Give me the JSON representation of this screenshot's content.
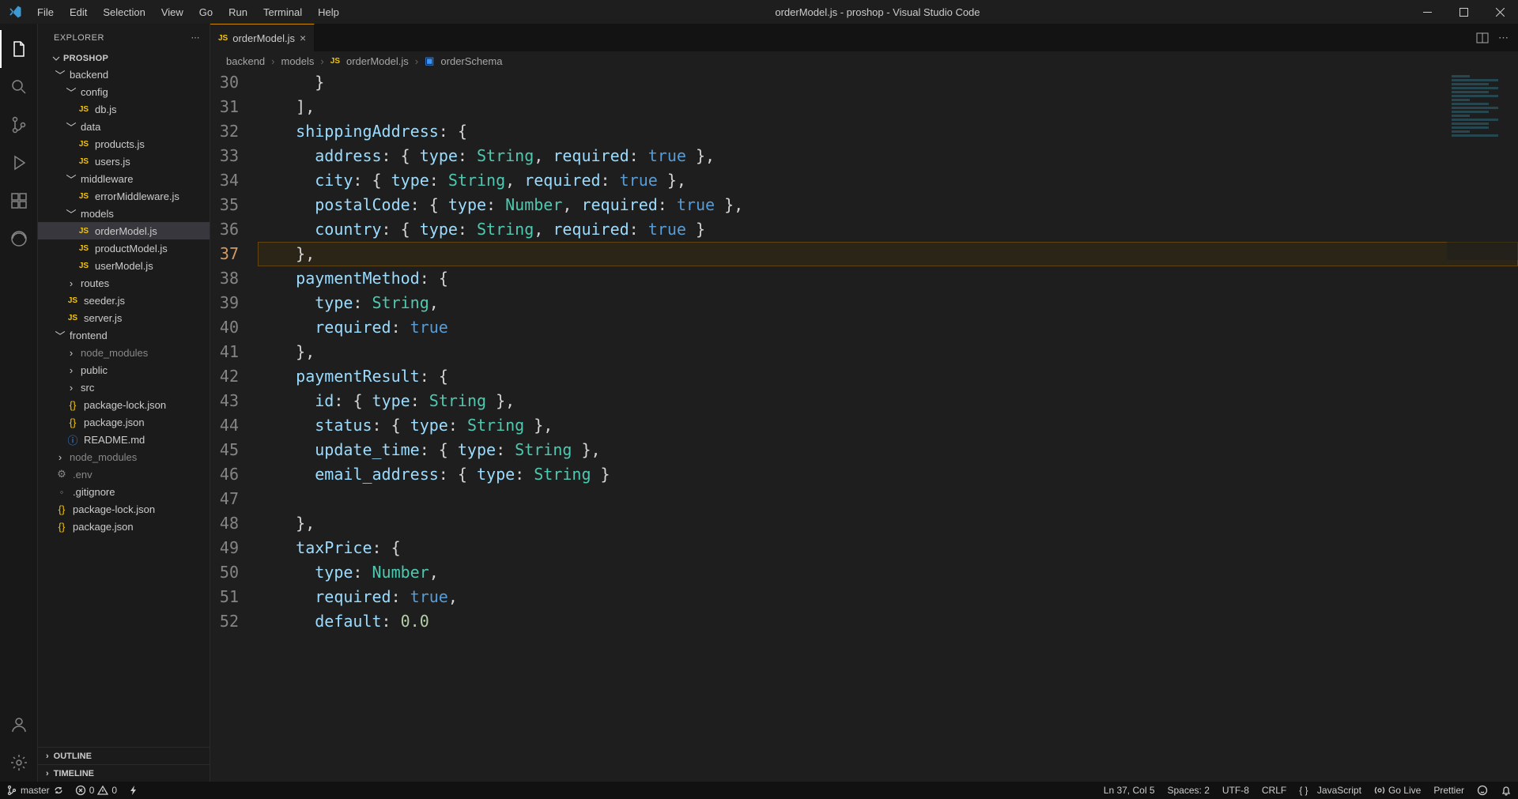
{
  "window": {
    "title": "orderModel.js - proshop - Visual Studio Code"
  },
  "menu": [
    "File",
    "Edit",
    "Selection",
    "View",
    "Go",
    "Run",
    "Terminal",
    "Help"
  ],
  "explorer": {
    "title": "EXPLORER",
    "project": "PROSHOP",
    "tree": {
      "backend": "backend",
      "config": "config",
      "db": "db.js",
      "data": "data",
      "products": "products.js",
      "users": "users.js",
      "middleware": "middleware",
      "errorMiddleware": "errorMiddleware.js",
      "models": "models",
      "orderModel": "orderModel.js",
      "productModel": "productModel.js",
      "userModel": "userModel.js",
      "routes": "routes",
      "seeder": "seeder.js",
      "server": "server.js",
      "frontend": "frontend",
      "node_modules_fe": "node_modules",
      "public": "public",
      "src": "src",
      "pkglock_fe": "package-lock.json",
      "pkg_fe": "package.json",
      "readme": "README.md",
      "node_modules_root": "node_modules",
      "env": ".env",
      "gitignore": ".gitignore",
      "pkglock_root": "package-lock.json",
      "pkg_root": "package.json"
    },
    "outline": "OUTLINE",
    "timeline": "TIMELINE"
  },
  "tab": {
    "fileLabel": "orderModel.js"
  },
  "breadcrumb": {
    "seg1": "backend",
    "seg2": "models",
    "seg3": "orderModel.js",
    "seg4": "orderSchema"
  },
  "code": {
    "lineStart": 30,
    "lines": [
      {
        "n": 30,
        "segs": [
          {
            "t": "      ",
            "c": "guide"
          },
          {
            "t": "}",
            "c": "brace"
          }
        ]
      },
      {
        "n": 31,
        "segs": [
          {
            "t": "    ",
            "c": "guide"
          },
          {
            "t": "],",
            "c": "punc"
          }
        ]
      },
      {
        "n": 32,
        "segs": [
          {
            "t": "    ",
            "c": "guide"
          },
          {
            "t": "shippingAddress",
            "c": "key"
          },
          {
            "t": ": ",
            "c": "punc"
          },
          {
            "t": "{",
            "c": "brace"
          }
        ]
      },
      {
        "n": 33,
        "segs": [
          {
            "t": "      ",
            "c": "guide"
          },
          {
            "t": "address",
            "c": "key"
          },
          {
            "t": ": ",
            "c": "punc"
          },
          {
            "t": "{ ",
            "c": "brace"
          },
          {
            "t": "type",
            "c": "key"
          },
          {
            "t": ": ",
            "c": "punc"
          },
          {
            "t": "String",
            "c": "type"
          },
          {
            "t": ", ",
            "c": "punc"
          },
          {
            "t": "required",
            "c": "key"
          },
          {
            "t": ": ",
            "c": "punc"
          },
          {
            "t": "true",
            "c": "bool"
          },
          {
            "t": " }",
            "c": "brace"
          },
          {
            "t": ",",
            "c": "punc"
          }
        ]
      },
      {
        "n": 34,
        "segs": [
          {
            "t": "      ",
            "c": "guide"
          },
          {
            "t": "city",
            "c": "key"
          },
          {
            "t": ": ",
            "c": "punc"
          },
          {
            "t": "{ ",
            "c": "brace"
          },
          {
            "t": "type",
            "c": "key"
          },
          {
            "t": ": ",
            "c": "punc"
          },
          {
            "t": "String",
            "c": "type"
          },
          {
            "t": ", ",
            "c": "punc"
          },
          {
            "t": "required",
            "c": "key"
          },
          {
            "t": ": ",
            "c": "punc"
          },
          {
            "t": "true",
            "c": "bool"
          },
          {
            "t": " }",
            "c": "brace"
          },
          {
            "t": ",",
            "c": "punc"
          }
        ]
      },
      {
        "n": 35,
        "segs": [
          {
            "t": "      ",
            "c": "guide"
          },
          {
            "t": "postalCode",
            "c": "key"
          },
          {
            "t": ": ",
            "c": "punc"
          },
          {
            "t": "{ ",
            "c": "brace"
          },
          {
            "t": "type",
            "c": "key"
          },
          {
            "t": ": ",
            "c": "punc"
          },
          {
            "t": "Number",
            "c": "type"
          },
          {
            "t": ", ",
            "c": "punc"
          },
          {
            "t": "required",
            "c": "key"
          },
          {
            "t": ": ",
            "c": "punc"
          },
          {
            "t": "true",
            "c": "bool"
          },
          {
            "t": " }",
            "c": "brace"
          },
          {
            "t": ",",
            "c": "punc"
          }
        ]
      },
      {
        "n": 36,
        "segs": [
          {
            "t": "      ",
            "c": "guide"
          },
          {
            "t": "country",
            "c": "key"
          },
          {
            "t": ": ",
            "c": "punc"
          },
          {
            "t": "{ ",
            "c": "brace"
          },
          {
            "t": "type",
            "c": "key"
          },
          {
            "t": ": ",
            "c": "punc"
          },
          {
            "t": "String",
            "c": "type"
          },
          {
            "t": ", ",
            "c": "punc"
          },
          {
            "t": "required",
            "c": "key"
          },
          {
            "t": ": ",
            "c": "punc"
          },
          {
            "t": "true",
            "c": "bool"
          },
          {
            "t": " }",
            "c": "brace"
          }
        ]
      },
      {
        "n": 37,
        "hl": true,
        "segs": [
          {
            "t": "    ",
            "c": "guide"
          },
          {
            "t": "}",
            "c": "brace"
          },
          {
            "t": ",",
            "c": "punc"
          }
        ]
      },
      {
        "n": 38,
        "segs": [
          {
            "t": "    ",
            "c": "guide"
          },
          {
            "t": "paymentMethod",
            "c": "key"
          },
          {
            "t": ": ",
            "c": "punc"
          },
          {
            "t": "{",
            "c": "brace"
          }
        ]
      },
      {
        "n": 39,
        "segs": [
          {
            "t": "      ",
            "c": "guide"
          },
          {
            "t": "type",
            "c": "key"
          },
          {
            "t": ": ",
            "c": "punc"
          },
          {
            "t": "String",
            "c": "type"
          },
          {
            "t": ",",
            "c": "punc"
          }
        ]
      },
      {
        "n": 40,
        "segs": [
          {
            "t": "      ",
            "c": "guide"
          },
          {
            "t": "required",
            "c": "key"
          },
          {
            "t": ": ",
            "c": "punc"
          },
          {
            "t": "true",
            "c": "bool"
          }
        ]
      },
      {
        "n": 41,
        "segs": [
          {
            "t": "    ",
            "c": "guide"
          },
          {
            "t": "}",
            "c": "brace"
          },
          {
            "t": ",",
            "c": "punc"
          }
        ]
      },
      {
        "n": 42,
        "segs": [
          {
            "t": "    ",
            "c": "guide"
          },
          {
            "t": "paymentResult",
            "c": "key"
          },
          {
            "t": ": ",
            "c": "punc"
          },
          {
            "t": "{",
            "c": "brace"
          }
        ]
      },
      {
        "n": 43,
        "segs": [
          {
            "t": "      ",
            "c": "guide"
          },
          {
            "t": "id",
            "c": "key"
          },
          {
            "t": ": ",
            "c": "punc"
          },
          {
            "t": "{ ",
            "c": "brace"
          },
          {
            "t": "type",
            "c": "key"
          },
          {
            "t": ": ",
            "c": "punc"
          },
          {
            "t": "String",
            "c": "type"
          },
          {
            "t": " }",
            "c": "brace"
          },
          {
            "t": ",",
            "c": "punc"
          }
        ]
      },
      {
        "n": 44,
        "segs": [
          {
            "t": "      ",
            "c": "guide"
          },
          {
            "t": "status",
            "c": "key"
          },
          {
            "t": ": ",
            "c": "punc"
          },
          {
            "t": "{ ",
            "c": "brace"
          },
          {
            "t": "type",
            "c": "key"
          },
          {
            "t": ": ",
            "c": "punc"
          },
          {
            "t": "String",
            "c": "type"
          },
          {
            "t": " }",
            "c": "brace"
          },
          {
            "t": ",",
            "c": "punc"
          }
        ]
      },
      {
        "n": 45,
        "segs": [
          {
            "t": "      ",
            "c": "guide"
          },
          {
            "t": "update_time",
            "c": "key"
          },
          {
            "t": ": ",
            "c": "punc"
          },
          {
            "t": "{ ",
            "c": "brace"
          },
          {
            "t": "type",
            "c": "key"
          },
          {
            "t": ": ",
            "c": "punc"
          },
          {
            "t": "String",
            "c": "type"
          },
          {
            "t": " }",
            "c": "brace"
          },
          {
            "t": ",",
            "c": "punc"
          }
        ]
      },
      {
        "n": 46,
        "segs": [
          {
            "t": "      ",
            "c": "guide"
          },
          {
            "t": "email_address",
            "c": "key"
          },
          {
            "t": ": ",
            "c": "punc"
          },
          {
            "t": "{ ",
            "c": "brace"
          },
          {
            "t": "type",
            "c": "key"
          },
          {
            "t": ": ",
            "c": "punc"
          },
          {
            "t": "String",
            "c": "type"
          },
          {
            "t": " }",
            "c": "brace"
          }
        ]
      },
      {
        "n": 47,
        "segs": [
          {
            "t": " ",
            "c": "guide"
          }
        ]
      },
      {
        "n": 48,
        "segs": [
          {
            "t": "    ",
            "c": "guide"
          },
          {
            "t": "}",
            "c": "brace"
          },
          {
            "t": ",",
            "c": "punc"
          }
        ]
      },
      {
        "n": 49,
        "segs": [
          {
            "t": "    ",
            "c": "guide"
          },
          {
            "t": "taxPrice",
            "c": "key"
          },
          {
            "t": ": ",
            "c": "punc"
          },
          {
            "t": "{",
            "c": "brace"
          }
        ]
      },
      {
        "n": 50,
        "segs": [
          {
            "t": "      ",
            "c": "guide"
          },
          {
            "t": "type",
            "c": "key"
          },
          {
            "t": ": ",
            "c": "punc"
          },
          {
            "t": "Number",
            "c": "type"
          },
          {
            "t": ",",
            "c": "punc"
          }
        ]
      },
      {
        "n": 51,
        "segs": [
          {
            "t": "      ",
            "c": "guide"
          },
          {
            "t": "required",
            "c": "key"
          },
          {
            "t": ": ",
            "c": "punc"
          },
          {
            "t": "true",
            "c": "bool"
          },
          {
            "t": ",",
            "c": "punc"
          }
        ]
      },
      {
        "n": 52,
        "segs": [
          {
            "t": "      ",
            "c": "guide"
          },
          {
            "t": "default",
            "c": "key"
          },
          {
            "t": ": ",
            "c": "punc"
          },
          {
            "t": "0.0",
            "c": "num"
          }
        ]
      }
    ]
  },
  "status": {
    "branch": "master",
    "errors": "0",
    "warnings": "0",
    "lncol": "Ln 37, Col 5",
    "spaces": "Spaces: 2",
    "encoding": "UTF-8",
    "eol": "CRLF",
    "lang": "JavaScript",
    "golive": "Go Live",
    "prettier": "Prettier"
  }
}
